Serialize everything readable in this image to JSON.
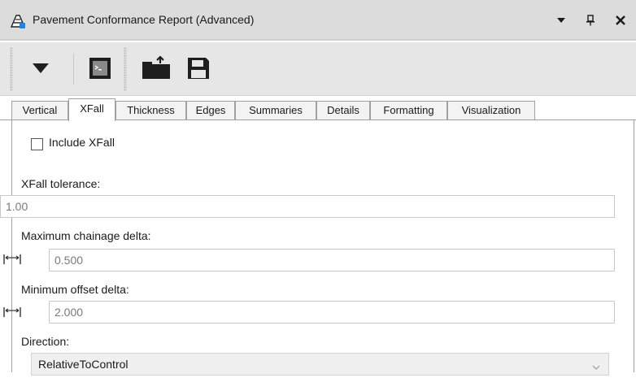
{
  "window": {
    "title": "Pavement Conformance Report (Advanced)"
  },
  "tabs": [
    {
      "label": "Vertical",
      "active": false
    },
    {
      "label": "XFall",
      "active": true
    },
    {
      "label": "Thickness",
      "active": false
    },
    {
      "label": "Edges",
      "active": false
    },
    {
      "label": "Summaries",
      "active": false
    },
    {
      "label": "Details",
      "active": false
    },
    {
      "label": "Formatting",
      "active": false
    },
    {
      "label": "Visualization",
      "active": false
    }
  ],
  "xfall": {
    "include_label": "Include XFall",
    "include_checked": false,
    "tolerance_label": "XFall tolerance:",
    "tolerance_value": "1.00",
    "max_chainage_label": "Maximum chainage delta:",
    "max_chainage_value": "0.500",
    "min_offset_label": "Minimum offset delta:",
    "min_offset_value": "2.000",
    "direction_label": "Direction:",
    "direction_value": "RelativeToControl"
  },
  "colors": {
    "titlebar_bg": "#dcdcdc",
    "toolbar_bg": "#e6e6e6",
    "icon_dark": "#1e1e1e"
  }
}
